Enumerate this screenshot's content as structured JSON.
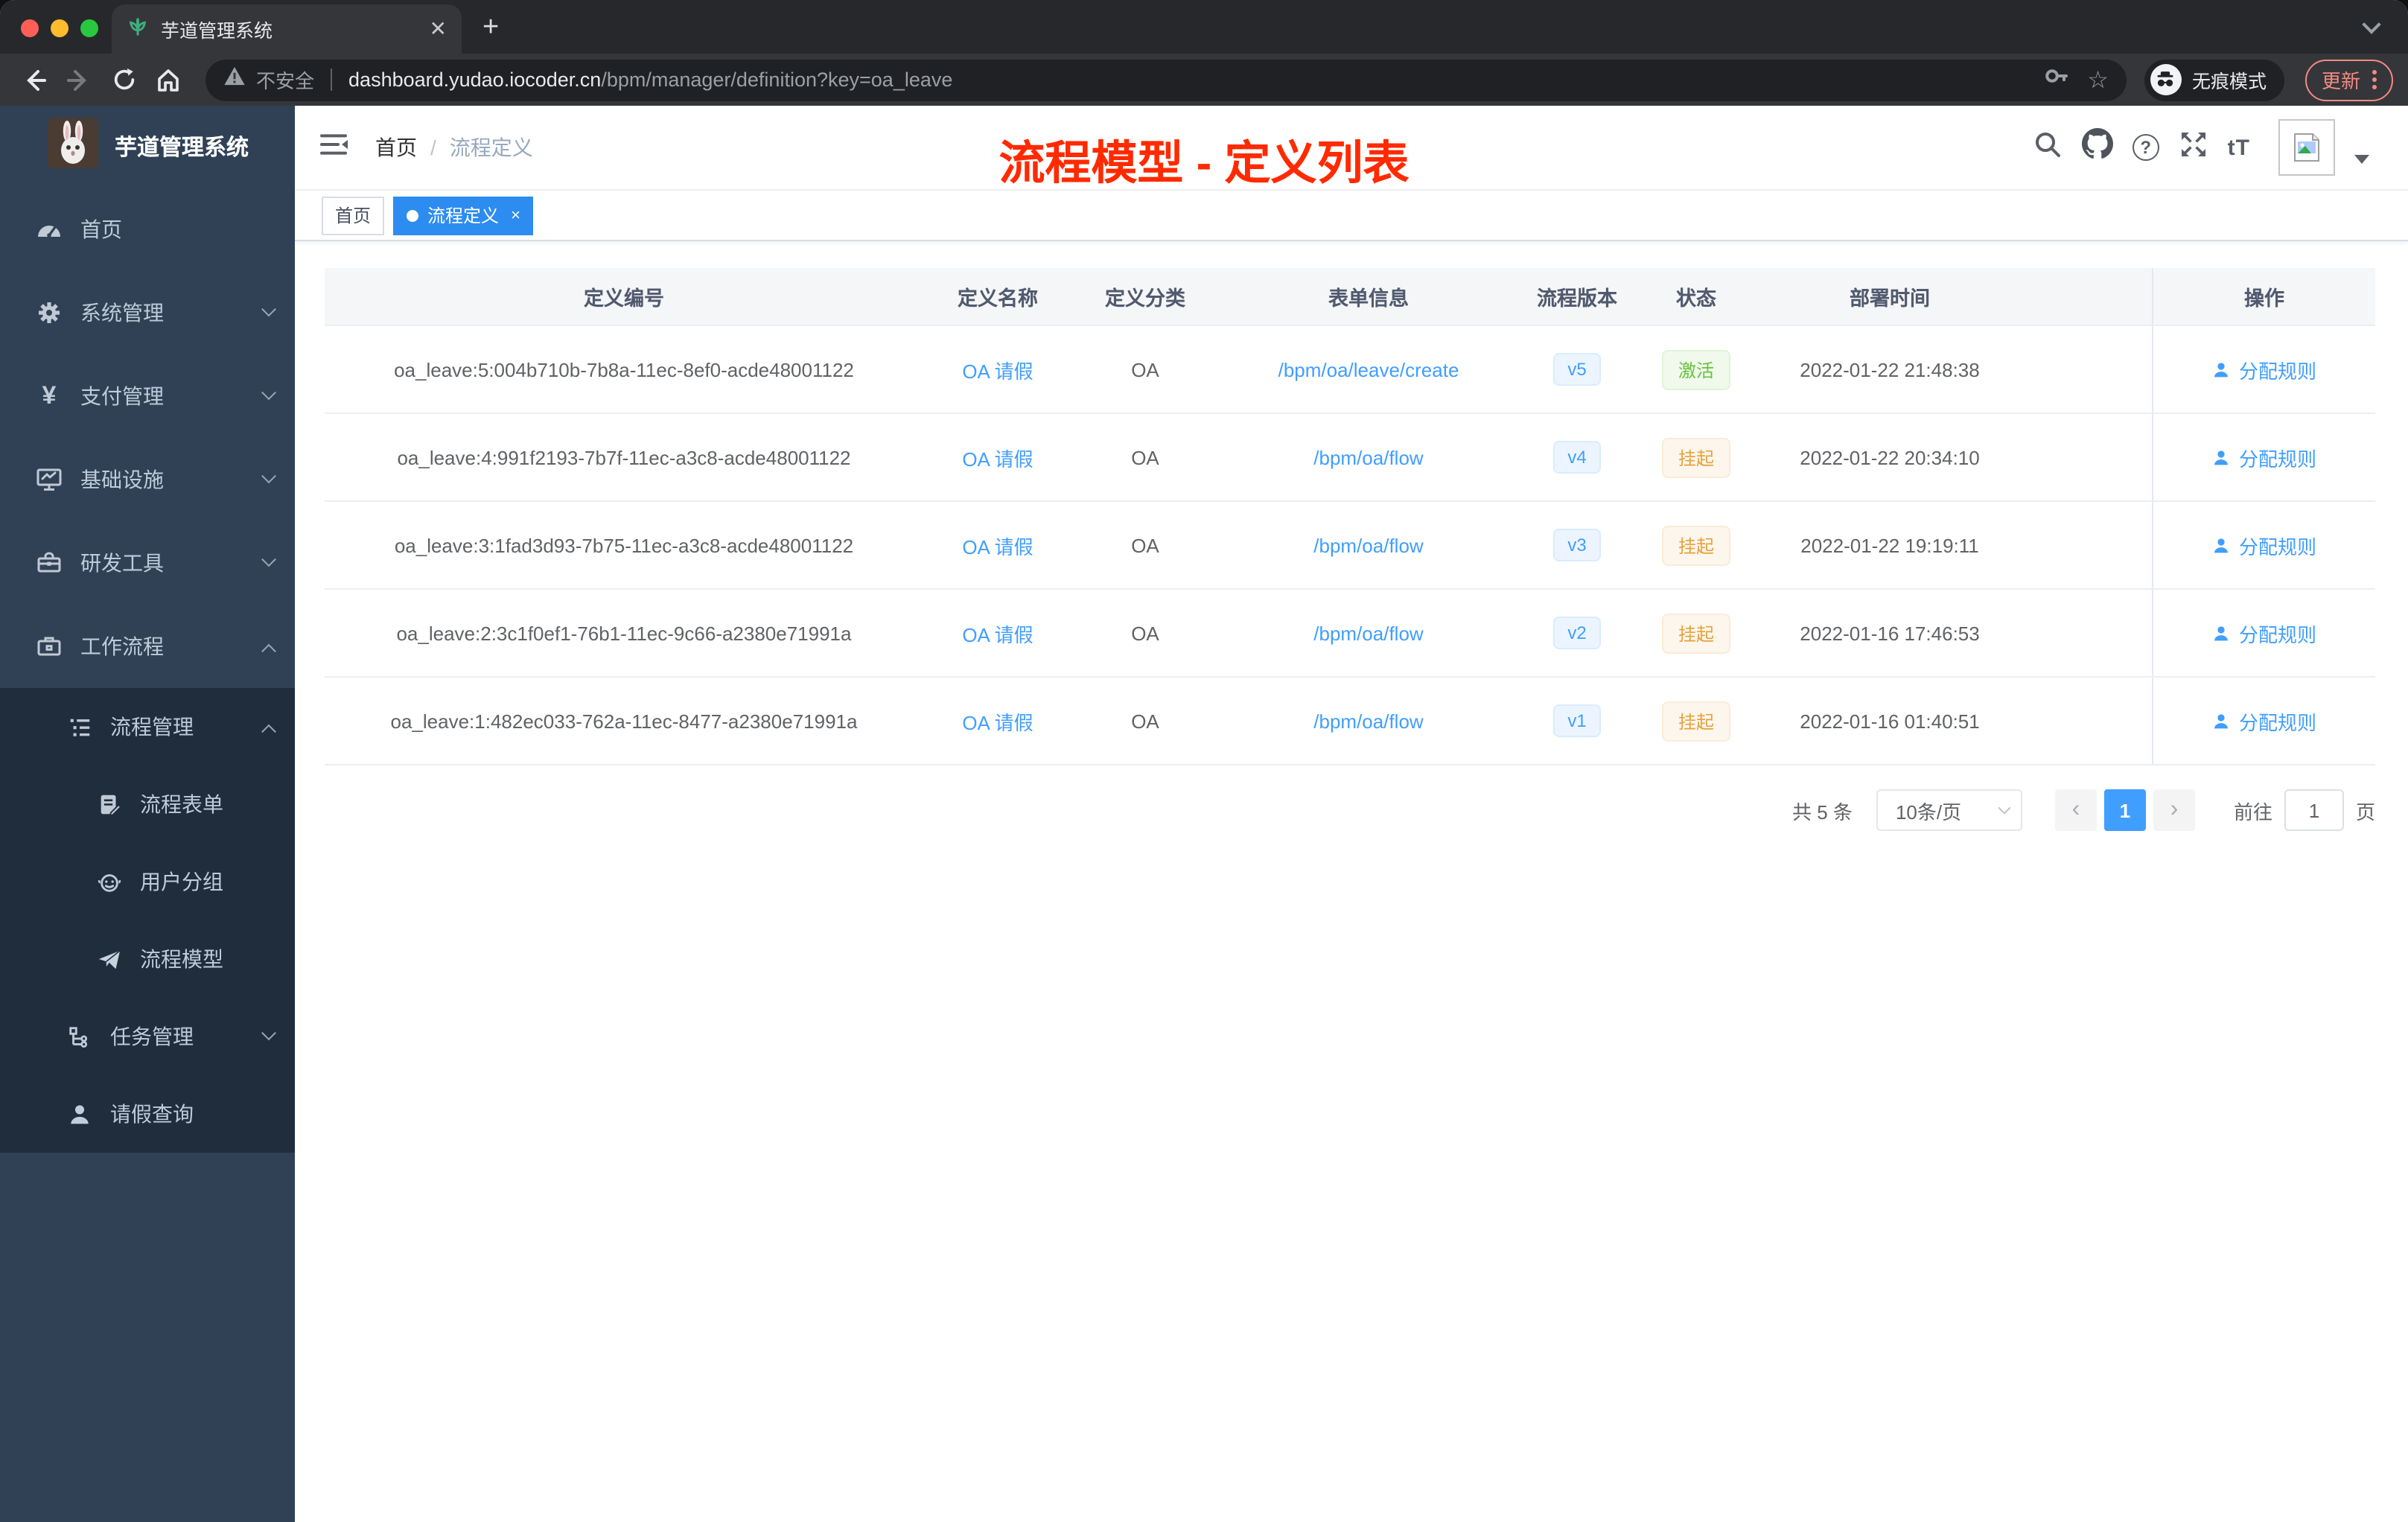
{
  "browser": {
    "tab": {
      "title": "芋道管理系统"
    },
    "new_tab_label": "+",
    "toolbar": {
      "security_label": "不安全",
      "url_host": "dashboard.yudao.iocoder.cn",
      "url_path": "/bpm/manager/definition?key=oa_leave",
      "incognito_label": "无痕模式",
      "update_label": "更新"
    }
  },
  "sidebar": {
    "logo_title": "芋道管理系统",
    "items": [
      {
        "label": "首页"
      },
      {
        "label": "系统管理"
      },
      {
        "label": "支付管理"
      },
      {
        "label": "基础设施"
      },
      {
        "label": "研发工具"
      },
      {
        "label": "工作流程"
      },
      {
        "label": "流程管理"
      },
      {
        "label": "流程表单"
      },
      {
        "label": "用户分组"
      },
      {
        "label": "流程模型"
      },
      {
        "label": "任务管理"
      },
      {
        "label": "请假查询"
      }
    ]
  },
  "header": {
    "breadcrumb": {
      "home": "首页",
      "separator": "/",
      "current": "流程定义"
    },
    "annotation": "流程模型 - 定义列表",
    "font_size_tool": "tT"
  },
  "tags": {
    "home": "首页",
    "active": "流程定义",
    "close": "×"
  },
  "table": {
    "columns": {
      "id": "定义编号",
      "name": "定义名称",
      "category": "定义分类",
      "form": "表单信息",
      "version": "流程版本",
      "status": "状态",
      "deploy_time": "部署时间",
      "actions": "操作"
    },
    "rows": [
      {
        "id": "oa_leave:5:004b710b-7b8a-11ec-8ef0-acde48001122",
        "name": "OA 请假",
        "category": "OA",
        "form": "/bpm/oa/leave/create",
        "version": "v5",
        "status": "激活",
        "deploy_time": "2022-01-22 21:48:38",
        "action": "分配规则"
      },
      {
        "id": "oa_leave:4:991f2193-7b7f-11ec-a3c8-acde48001122",
        "name": "OA 请假",
        "category": "OA",
        "form": "/bpm/oa/flow",
        "version": "v4",
        "status": "挂起",
        "deploy_time": "2022-01-22 20:34:10",
        "action": "分配规则"
      },
      {
        "id": "oa_leave:3:1fad3d93-7b75-11ec-a3c8-acde48001122",
        "name": "OA 请假",
        "category": "OA",
        "form": "/bpm/oa/flow",
        "version": "v3",
        "status": "挂起",
        "deploy_time": "2022-01-22 19:19:11",
        "action": "分配规则"
      },
      {
        "id": "oa_leave:2:3c1f0ef1-76b1-11ec-9c66-a2380e71991a",
        "name": "OA 请假",
        "category": "OA",
        "form": "/bpm/oa/flow",
        "version": "v2",
        "status": "挂起",
        "deploy_time": "2022-01-16 17:46:53",
        "action": "分配规则"
      },
      {
        "id": "oa_leave:1:482ec033-762a-11ec-8477-a2380e71991a",
        "name": "OA 请假",
        "category": "OA",
        "form": "/bpm/oa/flow",
        "version": "v1",
        "status": "挂起",
        "deploy_time": "2022-01-16 01:40:51",
        "action": "分配规则"
      }
    ]
  },
  "pagination": {
    "total": "共 5 条",
    "page_size": "10条/页",
    "prev": "‹",
    "current_page": "1",
    "next": "›",
    "goto_label": "前往",
    "goto_value": "1",
    "page_unit": "页"
  },
  "colors": {
    "accent_blue": "#409eff",
    "tag_active_blue": "#2d8cf0",
    "status_active_green": "#67c23a",
    "status_suspended_orange": "#e6a23c",
    "annotation_red": "#ff2a00",
    "sidebar_bg": "#304156",
    "sidebar_submenu_bg": "#1f2d3d",
    "update_red": "#f28b82"
  }
}
